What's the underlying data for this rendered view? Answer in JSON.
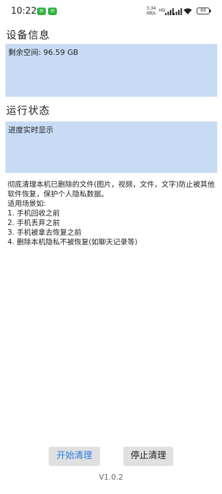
{
  "status_bar": {
    "time": "10:22",
    "notification_icons": [
      "wechat-icon",
      "wechat-icon"
    ],
    "net_speed": "3.34\nKB/s",
    "sim_label": "HD",
    "battery": "69"
  },
  "device_info": {
    "title": "设备信息",
    "free_space": "剩余空间: 96.59 GB"
  },
  "run_status": {
    "title": "运行状态",
    "progress_text": "进度实时显示"
  },
  "description": {
    "intro": "彻底清理本机已删除的文件(图片，视频，文件，文字)防止被其他软件恢复，保护个人隐私数据。",
    "scenarios_label": "适用场景如:",
    "scenarios": [
      "1. 手机回收之前",
      "2. 手机丢弃之前",
      "3. 手机被拿去恢复之前",
      "4. 删除本机隐私不被恢复(如聊天记录等)"
    ]
  },
  "actions": {
    "start_label": "开始清理",
    "stop_label": "停止清理"
  },
  "version": "V1.0.2",
  "colors": {
    "panel_bg": "#c7dcf4",
    "start_text": "#2a7de1",
    "button_bg": "#e0e0e0"
  }
}
